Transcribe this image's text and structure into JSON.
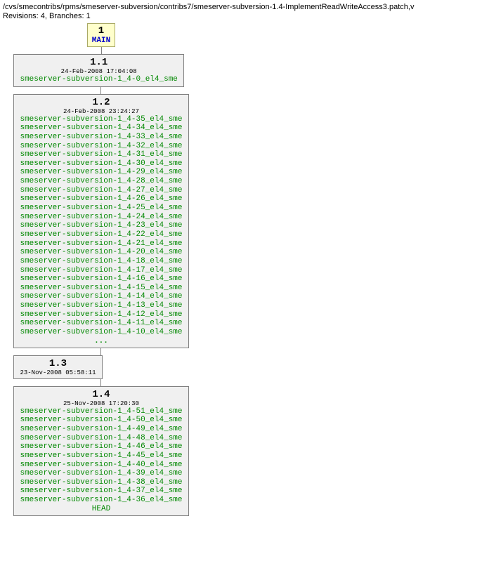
{
  "header": {
    "path": "/cvs/smecontribs/rpms/smeserver-subversion/contribs7/smeserver-subversion-1.4-ImplementReadWriteAccess3.patch,v",
    "info": "Revisions: 4, Branches: 1"
  },
  "main": {
    "version": "1",
    "label": "MAIN"
  },
  "nodes": [
    {
      "version": "1.1",
      "date": "24-Feb-2008 17:04:08",
      "tags": [
        "smeserver-subversion-1_4-0_el4_sme"
      ],
      "ellipsis": false,
      "head": false
    },
    {
      "version": "1.2",
      "date": "24-Feb-2008 23:24:27",
      "tags": [
        "smeserver-subversion-1_4-35_el4_sme",
        "smeserver-subversion-1_4-34_el4_sme",
        "smeserver-subversion-1_4-33_el4_sme",
        "smeserver-subversion-1_4-32_el4_sme",
        "smeserver-subversion-1_4-31_el4_sme",
        "smeserver-subversion-1_4-30_el4_sme",
        "smeserver-subversion-1_4-29_el4_sme",
        "smeserver-subversion-1_4-28_el4_sme",
        "smeserver-subversion-1_4-27_el4_sme",
        "smeserver-subversion-1_4-26_el4_sme",
        "smeserver-subversion-1_4-25_el4_sme",
        "smeserver-subversion-1_4-24_el4_sme",
        "smeserver-subversion-1_4-23_el4_sme",
        "smeserver-subversion-1_4-22_el4_sme",
        "smeserver-subversion-1_4-21_el4_sme",
        "smeserver-subversion-1_4-20_el4_sme",
        "smeserver-subversion-1_4-18_el4_sme",
        "smeserver-subversion-1_4-17_el4_sme",
        "smeserver-subversion-1_4-16_el4_sme",
        "smeserver-subversion-1_4-15_el4_sme",
        "smeserver-subversion-1_4-14_el4_sme",
        "smeserver-subversion-1_4-13_el4_sme",
        "smeserver-subversion-1_4-12_el4_sme",
        "smeserver-subversion-1_4-11_el4_sme",
        "smeserver-subversion-1_4-10_el4_sme"
      ],
      "ellipsis": true,
      "head": false
    },
    {
      "version": "1.3",
      "date": "23-Nov-2008 05:58:11",
      "tags": [],
      "ellipsis": false,
      "head": false
    },
    {
      "version": "1.4",
      "date": "25-Nov-2008 17:20:30",
      "tags": [
        "smeserver-subversion-1_4-51_el4_sme",
        "smeserver-subversion-1_4-50_el4_sme",
        "smeserver-subversion-1_4-49_el4_sme",
        "smeserver-subversion-1_4-48_el4_sme",
        "smeserver-subversion-1_4-46_el4_sme",
        "smeserver-subversion-1_4-45_el4_sme",
        "smeserver-subversion-1_4-40_el4_sme",
        "smeserver-subversion-1_4-39_el4_sme",
        "smeserver-subversion-1_4-38_el4_sme",
        "smeserver-subversion-1_4-37_el4_sme",
        "smeserver-subversion-1_4-36_el4_sme"
      ],
      "ellipsis": false,
      "head": true,
      "head_label": "HEAD"
    }
  ],
  "ellipsis_text": "..."
}
